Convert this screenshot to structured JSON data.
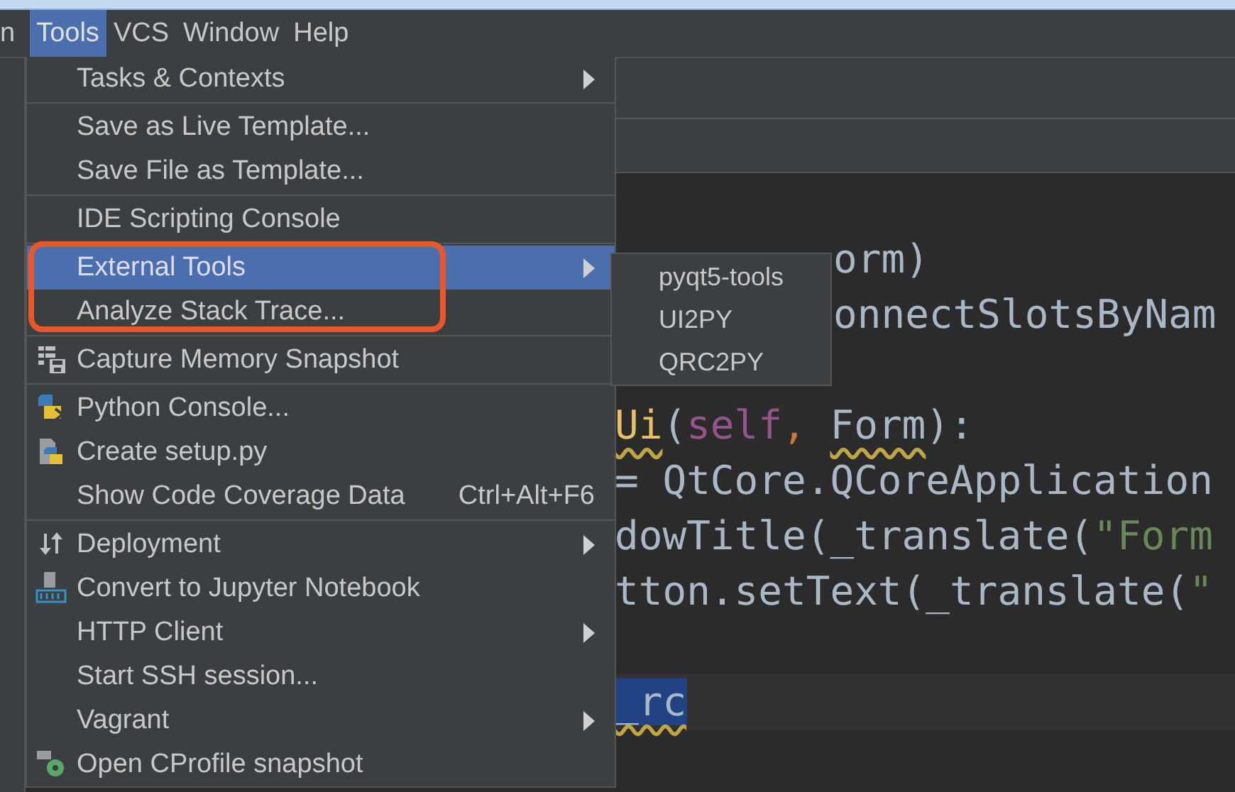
{
  "menu_bar": [
    {
      "label": "n",
      "selected": false
    },
    {
      "label": "Tools",
      "selected": true
    },
    {
      "label": "VCS",
      "selected": false
    },
    {
      "label": "Window",
      "selected": false
    },
    {
      "label": "Help",
      "selected": false
    }
  ],
  "tools_menu": [
    {
      "kind": "item",
      "label": "Tasks & Contexts",
      "submenu": true,
      "selected": false
    },
    {
      "kind": "separator"
    },
    {
      "kind": "item",
      "label": "Save as Live Template...",
      "submenu": false,
      "selected": false
    },
    {
      "kind": "item",
      "label": "Save File as Template...",
      "submenu": false,
      "selected": false
    },
    {
      "kind": "separator"
    },
    {
      "kind": "item",
      "label": "IDE Scripting Console",
      "submenu": false,
      "selected": false
    },
    {
      "kind": "separator"
    },
    {
      "kind": "item",
      "label": "External Tools",
      "submenu": true,
      "selected": true
    },
    {
      "kind": "item",
      "label": "Analyze Stack Trace...",
      "submenu": false,
      "selected": false
    },
    {
      "kind": "separator"
    },
    {
      "kind": "item",
      "label": "Capture Memory Snapshot",
      "submenu": false,
      "selected": false
    },
    {
      "kind": "separator"
    },
    {
      "kind": "item",
      "label": "Python Console...",
      "submenu": false,
      "selected": false
    },
    {
      "kind": "item",
      "label": "Create setup.py",
      "submenu": false,
      "selected": false
    },
    {
      "kind": "item",
      "label": "Show Code Coverage Data",
      "shortcut": "Ctrl+Alt+F6",
      "submenu": false,
      "selected": false
    },
    {
      "kind": "separator"
    },
    {
      "kind": "item",
      "label": "Deployment",
      "submenu": true,
      "selected": false
    },
    {
      "kind": "item",
      "label": "Convert to Jupyter Notebook",
      "submenu": false,
      "selected": false
    },
    {
      "kind": "item",
      "label": "HTTP Client",
      "submenu": true,
      "selected": false
    },
    {
      "kind": "item",
      "label": "Start SSH session...",
      "submenu": false,
      "selected": false
    },
    {
      "kind": "item",
      "label": "Vagrant",
      "submenu": true,
      "selected": false
    },
    {
      "kind": "item",
      "label": "Open CProfile snapshot",
      "submenu": false,
      "selected": false
    }
  ],
  "external_tools_submenu": [
    {
      "label": "pyqt5-tools",
      "selected": false
    },
    {
      "label": "UI2PY",
      "selected": false
    },
    {
      "label": "QRC2PY",
      "selected": false
    }
  ],
  "editor": {
    "lines": [
      {
        "kind": "under_submenu",
        "current": false,
        "tokens": [
          {
            "text": "orm)",
            "kind": "plain",
            "warning": false
          }
        ]
      },
      {
        "kind": "under_submenu",
        "current": false,
        "tokens": [
          {
            "text": "onnectSlotsByNam",
            "kind": "plain",
            "warning": false
          }
        ]
      },
      {
        "kind": "blank",
        "current": false
      },
      {
        "kind": "code",
        "current": false,
        "tokens": [
          {
            "text": "Ui",
            "kind": "function",
            "warning": true
          },
          {
            "text": "(",
            "kind": "plain",
            "warning": false
          },
          {
            "text": "self",
            "kind": "self",
            "warning": false
          },
          {
            "text": ", ",
            "kind": "keyword",
            "warning": false
          },
          {
            "text": "Form",
            "kind": "plain",
            "warning": true
          },
          {
            "text": "):",
            "kind": "plain",
            "warning": false
          }
        ]
      },
      {
        "kind": "code",
        "current": false,
        "tokens": [
          {
            "text": "= QtCore.QCoreApplication",
            "kind": "plain",
            "warning": false
          }
        ]
      },
      {
        "kind": "code",
        "current": false,
        "tokens": [
          {
            "text": "dowTitle(_translate(",
            "kind": "plain",
            "warning": false
          },
          {
            "text": "\"Form",
            "kind": "string",
            "warning": false
          }
        ]
      },
      {
        "kind": "code",
        "current": false,
        "tokens": [
          {
            "text": "tton.setText(_translate(",
            "kind": "plain",
            "warning": false
          },
          {
            "text": "\"",
            "kind": "string",
            "warning": false
          }
        ]
      },
      {
        "kind": "blank",
        "current": false
      },
      {
        "kind": "code",
        "current": true,
        "tokens": [
          {
            "text": "_rc",
            "kind": "selection",
            "warning": true
          }
        ]
      }
    ]
  },
  "annotation": {
    "kind": "highlight_frame"
  }
}
